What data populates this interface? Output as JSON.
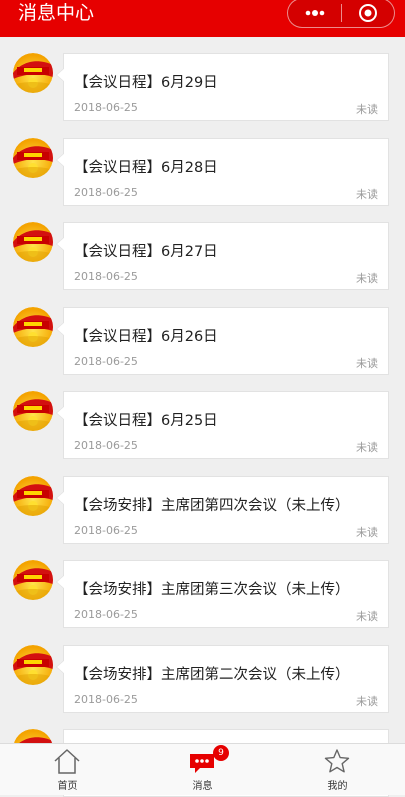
{
  "header": {
    "title": "消息中心",
    "more_icon": "more-dots-icon",
    "close_icon": "record-target-icon",
    "background": "#e60000"
  },
  "messages": [
    {
      "title": "【会议日程】6月29日",
      "date": "2018-06-25",
      "status": "未读",
      "avatar_icon": "league-emblem-icon"
    },
    {
      "title": "【会议日程】6月28日",
      "date": "2018-06-25",
      "status": "未读",
      "avatar_icon": "league-emblem-icon"
    },
    {
      "title": "【会议日程】6月27日",
      "date": "2018-06-25",
      "status": "未读",
      "avatar_icon": "league-emblem-icon"
    },
    {
      "title": "【会议日程】6月26日",
      "date": "2018-06-25",
      "status": "未读",
      "avatar_icon": "league-emblem-icon"
    },
    {
      "title": "【会议日程】6月25日",
      "date": "2018-06-25",
      "status": "未读",
      "avatar_icon": "league-emblem-icon"
    },
    {
      "title": "【会场安排】主席团第四次会议（未上传）",
      "date": "2018-06-25",
      "status": "未读",
      "avatar_icon": "league-emblem-icon"
    },
    {
      "title": "【会场安排】主席团第三次会议（未上传）",
      "date": "2018-06-25",
      "status": "未读",
      "avatar_icon": "league-emblem-icon"
    },
    {
      "title": "【会场安排】主席团第二次会议（未上传）",
      "date": "2018-06-25",
      "status": "未读",
      "avatar_icon": "league-emblem-icon"
    }
  ],
  "tabbar": {
    "tabs": [
      {
        "label": "首页",
        "icon": "home-icon"
      },
      {
        "label": "消息",
        "icon": "message-bubble-icon",
        "badge": "9"
      },
      {
        "label": "我的",
        "icon": "star-icon"
      }
    ],
    "active_color": "#e60000"
  }
}
